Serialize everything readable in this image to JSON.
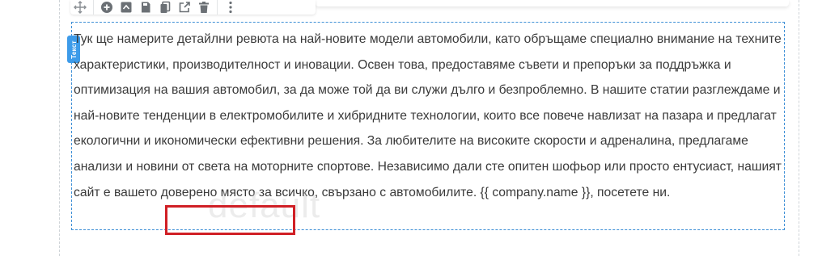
{
  "toolbar": {
    "items": [
      {
        "name": "move-icon"
      },
      {
        "name": "add-circle-icon"
      },
      {
        "name": "move-up-icon"
      },
      {
        "name": "save-icon"
      },
      {
        "name": "copy-icon"
      },
      {
        "name": "share-icon"
      },
      {
        "name": "trash-icon"
      },
      {
        "name": "more-vertical-icon"
      }
    ]
  },
  "text_block": {
    "tag_label": "Текст",
    "paragraph_before": "Тук ще намерите детайлни ревюта на най-новите модели автомобили, като обръщаме специално внимание на техните характеристики, производителност и иновации. Освен това, предоставяме съвети и препоръки за поддръжка и оптимизация на вашия автомобил, за да може той да ви служи дълго и безпроблемно. В нашите статии разглеждаме и най-новите тенденции в електромобилите и хибридните технологии, които все повече навлизат на пазара и предлагат екологични и икономически ефективни решения. За любителите на високите скорости и адреналина, предлагаме анализи и новини от света на моторните спортове. Независимо дали сте опитен шофьор или просто ентусиаст, нашият сайт е вашето доверено място за всичко, свързано с автомобилите.",
    "placeholder": "{{ company.name }}",
    "paragraph_after": ", посетете ни."
  },
  "watermark": "default",
  "colors": {
    "accent": "#3d9be9",
    "highlight": "#d01f25",
    "text": "#3a3a3a"
  }
}
